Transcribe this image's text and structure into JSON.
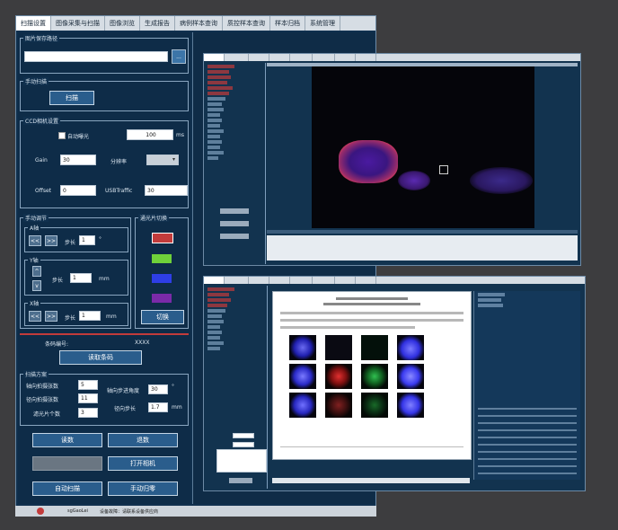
{
  "main_window": {
    "tabs": [
      {
        "label": "扫描设置",
        "active": true
      },
      {
        "label": "图像采集与扫描",
        "active": false
      },
      {
        "label": "图像浏览",
        "active": false
      },
      {
        "label": "生成报告",
        "active": false
      },
      {
        "label": "病例样本查询",
        "active": false
      },
      {
        "label": "质控样本查询",
        "active": false
      },
      {
        "label": "样本归档",
        "active": false
      },
      {
        "label": "系统管理",
        "active": false
      }
    ],
    "image_path": {
      "title": "图片保存路径",
      "value": "",
      "browse_label": "..."
    },
    "manual_scan": {
      "title": "手动扫描",
      "scan_label": "扫描"
    },
    "ccd": {
      "title": "CCD相机设置",
      "auto_exposure_label": "自动曝光",
      "exposure_value": "100",
      "exposure_unit": "ms",
      "gain_label": "Gain",
      "gain_value": "30",
      "resolution_label": "分辨率",
      "resolution_value": "",
      "offset_label": "Offset",
      "offset_value": "0",
      "usb_label": "USBTraffic",
      "usb_value": "30"
    },
    "manual_control": {
      "title": "手动调节",
      "a_axis": {
        "title": "A轴",
        "left": "<<",
        "right": ">>",
        "step_label": "步长",
        "step_value": "1",
        "unit": "°"
      },
      "y_axis": {
        "title": "Y轴",
        "up": "^",
        "down": "v",
        "step_label": "步长",
        "step_value": "1",
        "unit": "mm"
      },
      "x_axis": {
        "title": "X轴",
        "left": "<<",
        "right": ">>",
        "step_label": "步长",
        "step_value": "1",
        "unit": "mm"
      }
    },
    "channel": {
      "title": "通光片切换",
      "switch_label": "切换"
    },
    "sample_no": {
      "label": "条码编号:",
      "value": "XXXX"
    },
    "read_barcode_label": "读取条码",
    "scan_plan": {
      "title": "扫描方案",
      "axis_images_label": "轴向拍摄张数",
      "axis_images_value": "5",
      "radial_images_label": "径向拍摄张数",
      "radial_images_value": "11",
      "filter_count_label": "滤光片个数",
      "filter_count_value": "3",
      "axis_angle_label": "轴向步进角度",
      "axis_angle_value": "30",
      "axis_angle_unit": "°",
      "radial_step_label": "径向步长",
      "radial_step_value": "1.7",
      "radial_step_unit": "mm"
    },
    "actions": {
      "pause": "读数",
      "stop": "退数",
      "blank": "",
      "open_camera": "打开相机",
      "auto_scan": "自动扫描",
      "manual_return": "手动归零"
    },
    "status": {
      "user": "sgGaoLei",
      "message": "设备故障：请联系设备供应商"
    }
  },
  "colors": {
    "panel_bg": "#10304e",
    "button_bg": "#2a5d8c",
    "accent_red": "#c23b3b",
    "accent_green": "#6fd13a",
    "accent_blue": "#2e3ee6",
    "accent_purple": "#7a2aa8"
  }
}
